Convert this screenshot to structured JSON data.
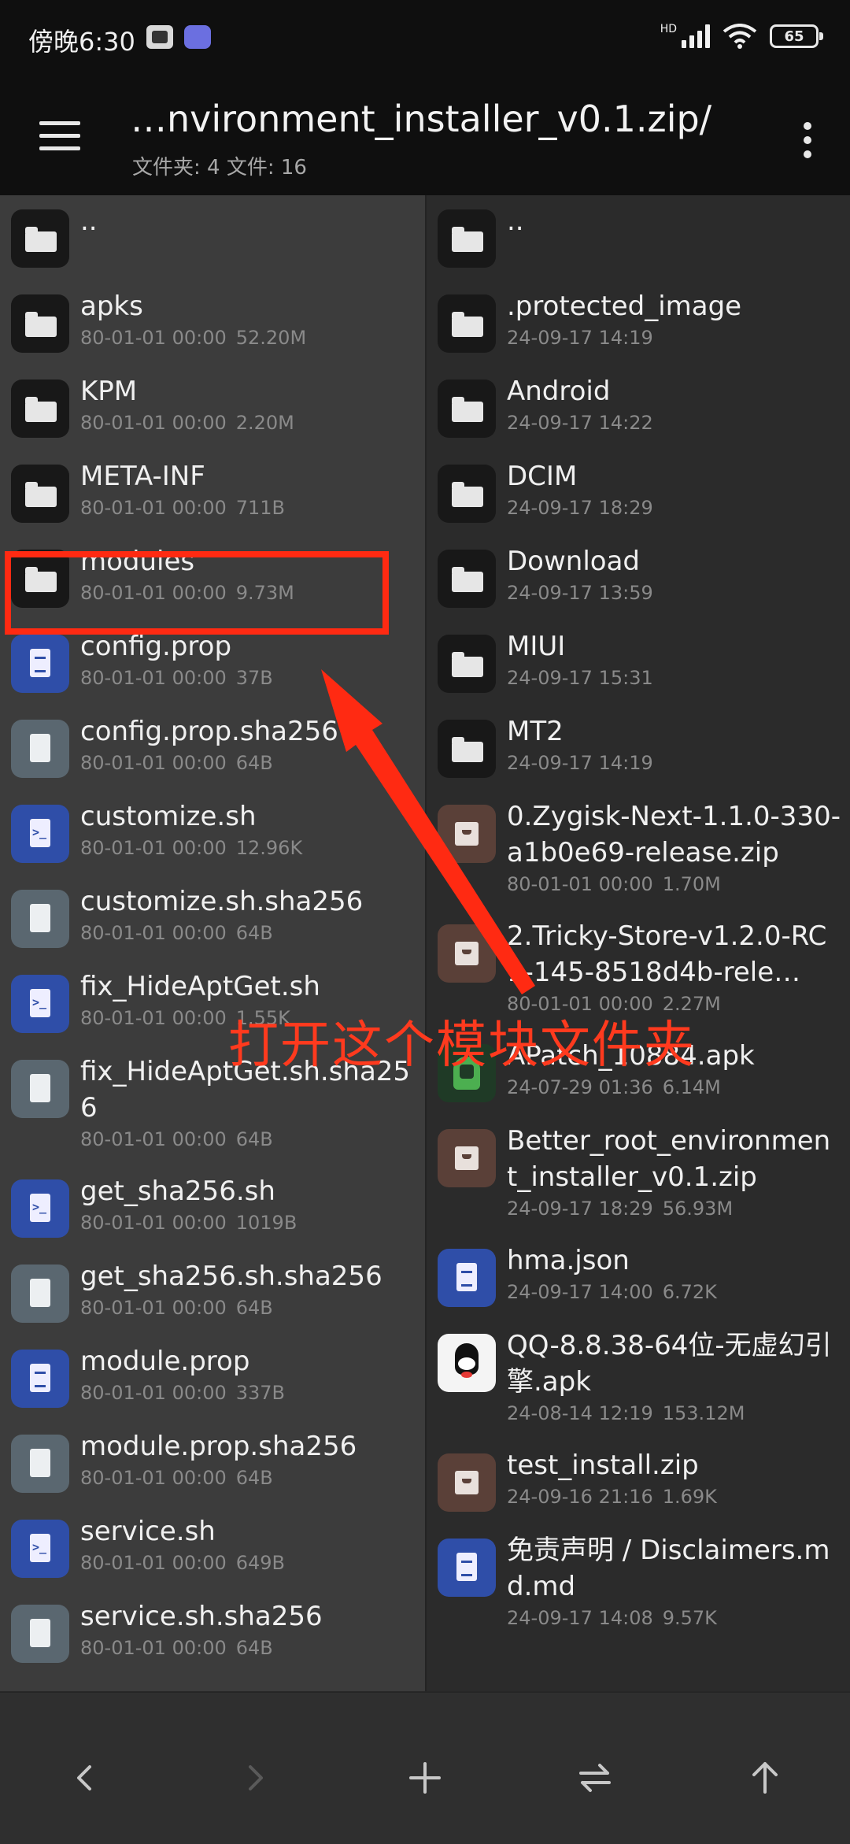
{
  "status_bar": {
    "time": "傍晚6:30",
    "network_label": "HD",
    "battery": "65"
  },
  "toolbar": {
    "title": "…nvironment_installer_v0.1.zip/",
    "subtitle": "文件夹: 4  文件: 16"
  },
  "left_pane": {
    "items": [
      {
        "name": "..",
        "date": "",
        "size": "",
        "icon": "folder-icon"
      },
      {
        "name": "apks",
        "date": "80-01-01 00:00",
        "size": "52.20M",
        "icon": "folder-icon"
      },
      {
        "name": "KPM",
        "date": "80-01-01 00:00",
        "size": "2.20M",
        "icon": "folder-icon"
      },
      {
        "name": "META-INF",
        "date": "80-01-01 00:00",
        "size": "711B",
        "icon": "folder-icon"
      },
      {
        "name": "modules",
        "date": "80-01-01 00:00",
        "size": "9.73M",
        "icon": "folder-icon"
      },
      {
        "name": "config.prop",
        "date": "80-01-01 00:00",
        "size": "37B",
        "icon": "text-file-icon"
      },
      {
        "name": "config.prop.sha256",
        "date": "80-01-01 00:00",
        "size": "64B",
        "icon": "file-icon"
      },
      {
        "name": "customize.sh",
        "date": "80-01-01 00:00",
        "size": "12.96K",
        "icon": "shell-script-icon"
      },
      {
        "name": "customize.sh.sha256",
        "date": "80-01-01 00:00",
        "size": "64B",
        "icon": "file-icon"
      },
      {
        "name": "fix_HideAptGet.sh",
        "date": "80-01-01 00:00",
        "size": "1.55K",
        "icon": "shell-script-icon"
      },
      {
        "name": "fix_HideAptGet.sh.sha256",
        "date": "80-01-01 00:00",
        "size": "64B",
        "icon": "file-icon"
      },
      {
        "name": "get_sha256.sh",
        "date": "80-01-01 00:00",
        "size": "1019B",
        "icon": "shell-script-icon"
      },
      {
        "name": "get_sha256.sh.sha256",
        "date": "80-01-01 00:00",
        "size": "64B",
        "icon": "file-icon"
      },
      {
        "name": "module.prop",
        "date": "80-01-01 00:00",
        "size": "337B",
        "icon": "text-file-icon"
      },
      {
        "name": "module.prop.sha256",
        "date": "80-01-01 00:00",
        "size": "64B",
        "icon": "file-icon"
      },
      {
        "name": "service.sh",
        "date": "80-01-01 00:00",
        "size": "649B",
        "icon": "shell-script-icon"
      },
      {
        "name": "service.sh.sha256",
        "date": "80-01-01 00:00",
        "size": "64B",
        "icon": "file-icon"
      }
    ]
  },
  "right_pane": {
    "items": [
      {
        "name": "..",
        "date": "",
        "size": "",
        "icon": "folder-icon"
      },
      {
        "name": ".protected_image",
        "date": "24-09-17 14:19",
        "size": "",
        "icon": "folder-icon"
      },
      {
        "name": "Android",
        "date": "24-09-17 14:22",
        "size": "",
        "icon": "folder-icon"
      },
      {
        "name": "DCIM",
        "date": "24-09-17 18:29",
        "size": "",
        "icon": "folder-icon"
      },
      {
        "name": "Download",
        "date": "24-09-17 13:59",
        "size": "",
        "icon": "folder-icon"
      },
      {
        "name": "MIUI",
        "date": "24-09-17 15:31",
        "size": "",
        "icon": "folder-icon"
      },
      {
        "name": "MT2",
        "date": "24-09-17 14:19",
        "size": "",
        "icon": "folder-icon"
      },
      {
        "name": "0.Zygisk-Next-1.1.0-330-a1b0e69-release.zip",
        "date": "80-01-01 00:00",
        "size": "1.70M",
        "icon": "archive-icon"
      },
      {
        "name": "2.Tricky-Store-v1.2.0-RC1-145-8518d4b-rele…",
        "date": "80-01-01 00:00",
        "size": "2.27M",
        "icon": "archive-icon"
      },
      {
        "name": "APatch_10884.apk",
        "date": "24-07-29 01:36",
        "size": "6.14M",
        "icon": "android-apk-icon"
      },
      {
        "name": "Better_root_environment_installer_v0.1.zip",
        "date": "24-09-17 18:29",
        "size": "56.93M",
        "icon": "archive-icon"
      },
      {
        "name": "hma.json",
        "date": "24-09-17 14:00",
        "size": "6.72K",
        "icon": "text-file-icon"
      },
      {
        "name": "QQ-8.8.38-64位-无虚幻引擎.apk",
        "date": "24-08-14 12:19",
        "size": "153.12M",
        "icon": "qq-app-icon"
      },
      {
        "name": "test_install.zip",
        "date": "24-09-16 21:16",
        "size": "1.69K",
        "icon": "archive-icon"
      },
      {
        "name": "免责声明 / Disclaimers.md.md",
        "date": "24-09-17 14:08",
        "size": "9.57K",
        "icon": "text-file-icon"
      }
    ]
  },
  "annotation": {
    "text": "打开这个模块文件夹",
    "color": "#ff2a12"
  },
  "bottom_bar": {
    "buttons": [
      "back-arrow-icon",
      "forward-arrow-icon",
      "plus-icon",
      "swap-icon",
      "up-arrow-icon"
    ]
  },
  "colors": {
    "left_pane_bg": "#3c3c3c",
    "right_pane_bg": "#2b2b2b",
    "toolbar_bg": "#0f0f0f"
  }
}
